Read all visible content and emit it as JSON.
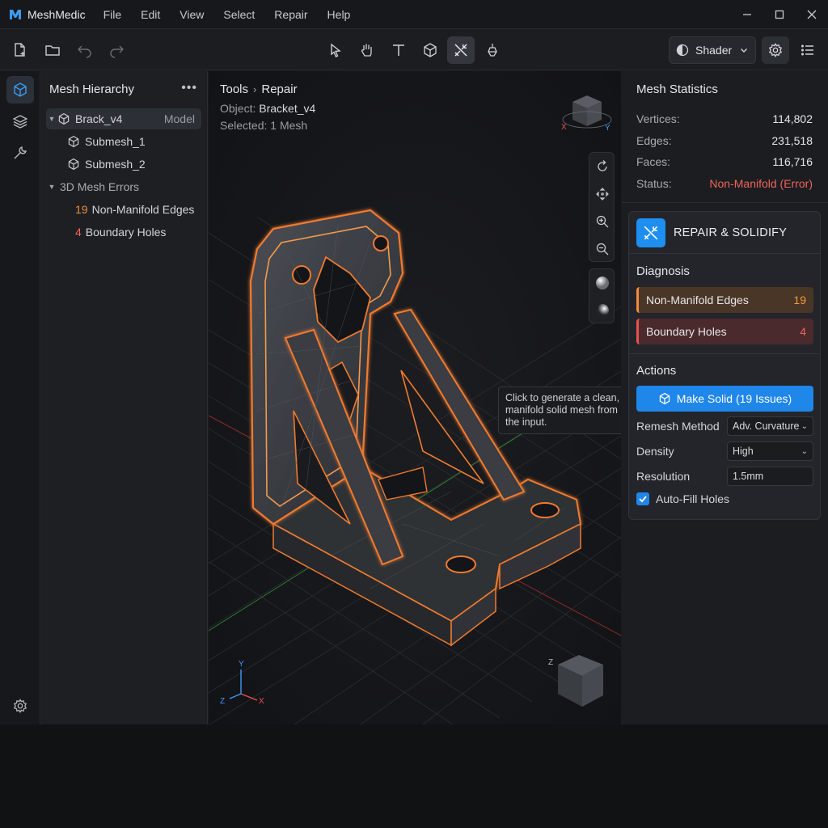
{
  "app": {
    "name": "MeshMedic"
  },
  "menu": [
    "File",
    "Edit",
    "View",
    "Select",
    "Repair",
    "Help"
  ],
  "toolbar": {
    "shader_label": "Shader"
  },
  "hierarchy": {
    "title": "Mesh Hierarchy",
    "root": {
      "label": "Brack_v4",
      "tag": "Model"
    },
    "submeshes": [
      "Submesh_1",
      "Submesh_2"
    ],
    "errors_group": "3D Mesh Errors",
    "errors": [
      {
        "count": "19",
        "label": "Non-Manifold Edges"
      },
      {
        "count": "4",
        "label": "Boundary Holes"
      }
    ]
  },
  "viewport": {
    "breadcrumb": [
      "Tools",
      "Repair"
    ],
    "object_label": "Object:",
    "object_value": "Bracket_v4",
    "selected_label": "Selected:",
    "selected_value": "1 Mesh",
    "tooltip": "Click to generate a clean, manifold solid mesh from the input.",
    "axis": {
      "x": "X",
      "y": "Y",
      "z": "Z"
    }
  },
  "stats": {
    "title": "Mesh Statistics",
    "rows": [
      {
        "label": "Vertices:",
        "value": "114,802"
      },
      {
        "label": "Edges:",
        "value": "231,518"
      },
      {
        "label": "Faces:",
        "value": "116,716"
      },
      {
        "label": "Status:",
        "value": "Non-Manifold (Error)"
      }
    ]
  },
  "repair": {
    "title": "REPAIR & SOLIDIFY",
    "diagnosis_label": "Diagnosis",
    "diagnosis": [
      {
        "label": "Non-Manifold Edges",
        "count": "19"
      },
      {
        "label": "Boundary Holes",
        "count": "4"
      }
    ],
    "actions_label": "Actions",
    "make_solid": "Make Solid (19 Issues)",
    "remesh_label": "Remesh Method",
    "remesh_value": "Adv. Curvature",
    "density_label": "Density",
    "density_value": "High",
    "resolution_label": "Resolution",
    "resolution_value": "1.5mm",
    "autofill_label": "Auto-Fill Holes",
    "autofill_checked": true
  },
  "colors": {
    "accent": "#1f86ea",
    "error": "#f2645a",
    "warning": "#f28c3a"
  }
}
